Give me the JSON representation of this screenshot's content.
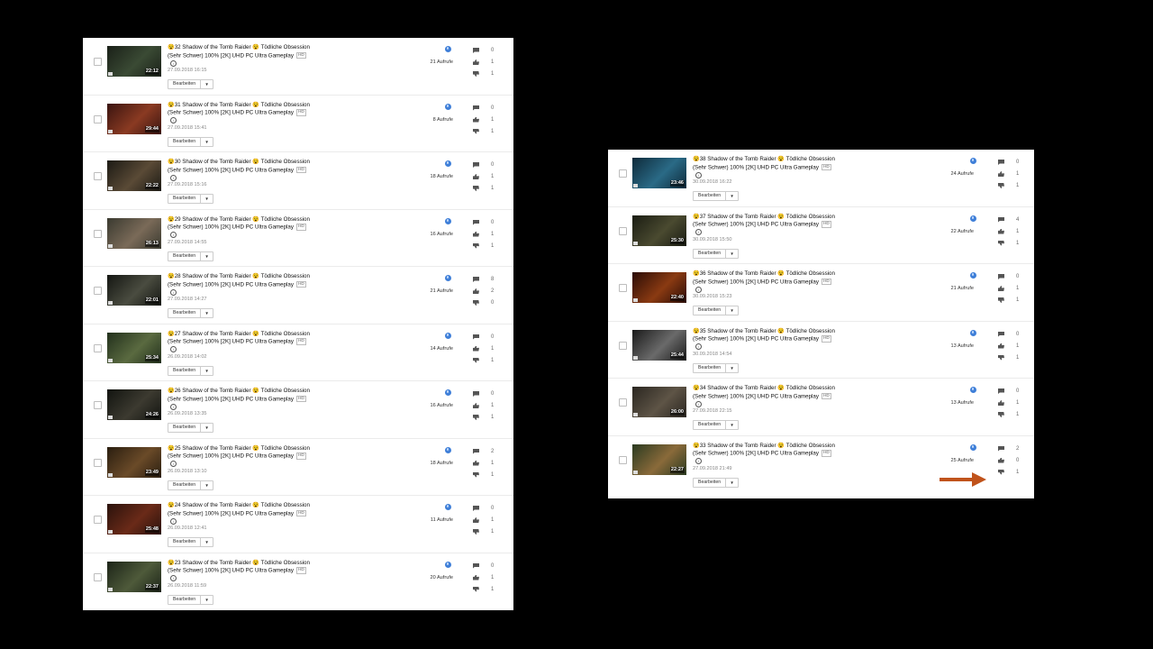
{
  "edit_label": "Bearbeiten",
  "hd_badge": "HD",
  "accent_colors": {
    "globe": "#3f7fd8",
    "arrow": "#c0531b"
  },
  "icons": {
    "visibility": "globe-icon",
    "comments": "comment-icon",
    "likes": "thumbs-up-icon",
    "dislikes": "thumbs-down-icon",
    "menu": "chevron-down-icon"
  },
  "left_videos": [
    {
      "title": "😵32 Shadow of the Tomb Raider 😵 Tödliche Obsession (Sehr Schwer) 100% [2K] UHD PC Ultra Gameplay",
      "date": "27.09.2018 16:15",
      "duration": "22:12",
      "views": "21 Aufrufe",
      "comments": "0",
      "likes": "1",
      "dislikes": "1",
      "thumb": [
        "#1a2018",
        "#3a4a34"
      ]
    },
    {
      "title": "😵31 Shadow of the Tomb Raider 😵 Tödliche Obsession (Sehr Schwer) 100% [2K] UHD PC Ultra Gameplay",
      "date": "27.09.2018 15:41",
      "duration": "29:44",
      "views": "8 Aufrufe",
      "comments": "0",
      "likes": "1",
      "dislikes": "1",
      "thumb": [
        "#3a1410",
        "#8a3a22"
      ]
    },
    {
      "title": "😵30 Shadow of the Tomb Raider 😵 Tödliche Obsession (Sehr Schwer) 100% [2K] UHD PC Ultra Gameplay",
      "date": "27.09.2018 15:16",
      "duration": "22:22",
      "views": "18 Aufrufe",
      "comments": "0",
      "likes": "1",
      "dislikes": "1",
      "thumb": [
        "#1c1a14",
        "#5a4a36"
      ]
    },
    {
      "title": "😵29 Shadow of the Tomb Raider 😵 Tödliche Obsession (Sehr Schwer) 100% [2K] UHD PC Ultra Gameplay",
      "date": "27.09.2018 14:55",
      "duration": "26:13",
      "views": "16 Aufrufe",
      "comments": "0",
      "likes": "1",
      "dislikes": "1",
      "thumb": [
        "#3a3a30",
        "#7a6a58"
      ]
    },
    {
      "title": "😵28 Shadow of the Tomb Raider 😵 Tödliche Obsession (Sehr Schwer) 100% [2K] UHD PC Ultra Gameplay",
      "date": "27.09.2018 14:27",
      "duration": "22:01",
      "views": "21 Aufrufe",
      "comments": "8",
      "likes": "2",
      "dislikes": "0",
      "thumb": [
        "#141612",
        "#4a4c40"
      ]
    },
    {
      "title": "😵27 Shadow of the Tomb Raider 😵 Tödliche Obsession (Sehr Schwer) 100% [2K] UHD PC Ultra Gameplay",
      "date": "26.09.2018 14:02",
      "duration": "25:34",
      "views": "14 Aufrufe",
      "comments": "0",
      "likes": "1",
      "dislikes": "1",
      "thumb": [
        "#22301c",
        "#5a6a40"
      ]
    },
    {
      "title": "😵26 Shadow of the Tomb Raider 😵 Tödliche Obsession (Sehr Schwer) 100% [2K] UHD PC Ultra Gameplay",
      "date": "26.09.2018 13:35",
      "duration": "24:26",
      "views": "16 Aufrufe",
      "comments": "0",
      "likes": "1",
      "dislikes": "1",
      "thumb": [
        "#121410",
        "#3c3a30"
      ]
    },
    {
      "title": "😵25 Shadow of the Tomb Raider 😵 Tödliche Obsession (Sehr Schwer) 100% [2K] UHD PC Ultra Gameplay",
      "date": "26.09.2018 13:10",
      "duration": "23:49",
      "views": "18 Aufrufe",
      "comments": "2",
      "likes": "1",
      "dislikes": "1",
      "thumb": [
        "#2a1e10",
        "#6a4a28"
      ]
    },
    {
      "title": "😵24 Shadow of the Tomb Raider 😵 Tödliche Obsession (Sehr Schwer) 100% [2K] UHD PC Ultra Gameplay",
      "date": "26.09.2018 12:41",
      "duration": "25:48",
      "views": "11 Aufrufe",
      "comments": "0",
      "likes": "1",
      "dislikes": "1",
      "thumb": [
        "#2a120c",
        "#6a2a18"
      ]
    },
    {
      "title": "😵23 Shadow of the Tomb Raider 😵 Tödliche Obsession (Sehr Schwer) 100% [2K] UHD PC Ultra Gameplay",
      "date": "26.09.2018 11:59",
      "duration": "22:37",
      "views": "20 Aufrufe",
      "comments": "0",
      "likes": "1",
      "dislikes": "1",
      "thumb": [
        "#1c2418",
        "#4e5a3a"
      ]
    }
  ],
  "right_videos": [
    {
      "title": "😵38 Shadow of the Tomb Raider 😵 Tödliche Obsession (Sehr Schwer) 100% [2K] UHD PC Ultra Gameplay",
      "date": "30.09.2018 16:22",
      "duration": "23:46",
      "views": "24 Aufrufe",
      "comments": "0",
      "likes": "1",
      "dislikes": "1",
      "thumb": [
        "#0e2a3a",
        "#2a6a86"
      ]
    },
    {
      "title": "😵37 Shadow of the Tomb Raider 😵 Tödliche Obsession (Sehr Schwer) 100% [2K] UHD PC Ultra Gameplay",
      "date": "30.09.2018 15:50",
      "duration": "25:30",
      "views": "22 Aufrufe",
      "comments": "4",
      "likes": "1",
      "dislikes": "1",
      "thumb": [
        "#1a1c12",
        "#4a4a30"
      ]
    },
    {
      "title": "😵36 Shadow of the Tomb Raider 😵 Tödliche Obsession (Sehr Schwer) 100% [2K] UHD PC Ultra Gameplay",
      "date": "30.09.2018 15:23",
      "duration": "22:40",
      "views": "21 Aufrufe",
      "comments": "0",
      "likes": "1",
      "dislikes": "1",
      "thumb": [
        "#2a0c06",
        "#8a3a12"
      ]
    },
    {
      "title": "😵35 Shadow of the Tomb Raider 😵 Tödliche Obsession (Sehr Schwer) 100% [2K] UHD PC Ultra Gameplay",
      "date": "30.09.2018 14:54",
      "duration": "25:44",
      "views": "13 Aufrufe",
      "comments": "0",
      "likes": "1",
      "dislikes": "1",
      "thumb": [
        "#1a1a1a",
        "#6a6a6a"
      ]
    },
    {
      "title": "😵34 Shadow of the Tomb Raider 😵 Tödliche Obsession (Sehr Schwer) 100% [2K] UHD PC Ultra Gameplay",
      "date": "27.09.2018 22:15",
      "duration": "26:00",
      "views": "13 Aufrufe",
      "comments": "0",
      "likes": "1",
      "dislikes": "1",
      "thumb": [
        "#2a2620",
        "#5e5446"
      ]
    },
    {
      "title": "😵33 Shadow of the Tomb Raider 😵 Tödliche Obsession (Sehr Schwer) 100% [2K] UHD PC Ultra Gameplay",
      "date": "27.09.2018 21:49",
      "duration": "22:27",
      "views": "25 Aufrufe",
      "comments": "2",
      "likes": "0",
      "dislikes": "1",
      "thumb": [
        "#2a3a20",
        "#8a6a3a"
      ]
    }
  ]
}
